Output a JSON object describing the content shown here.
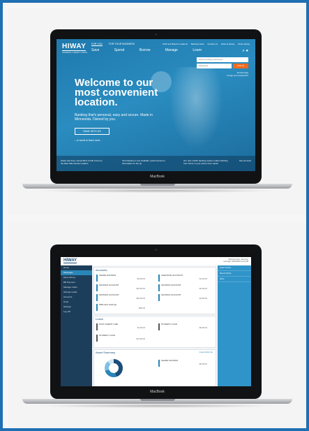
{
  "laptop_label": "MacBook",
  "website": {
    "logo": "HIWAY",
    "logo_sub": "FEDERAL CREDIT UNION",
    "tabs": [
      "FOR YOU",
      "FOR YOUR BUSINESS"
    ],
    "nav": [
      "Save",
      "Spend",
      "Borrow",
      "Manage",
      "Learn"
    ],
    "top_links": [
      "ATM and Branch Locations",
      "Banking Tools",
      "Contact Us",
      "Work at Hiway",
      "About Hiway"
    ],
    "login": {
      "username_placeholder": "Online banking username",
      "password_placeholder": "Password",
      "button": "LOG IN",
      "enroll": "Enroll today",
      "forgot": "Forgot your password?"
    },
    "hero_title": "Welcome to our most convenient location.",
    "hero_sub": "Banking that's personal, easy and secure. Made in Minnesota. Owned by you.",
    "bank_button": "BANK WITH US",
    "scroll_hint": "or scroll to learn more",
    "news": [
      "Hiway has been named Best Credit Union by the East Side Review readers",
      "Text banking is now available. Quick access to information on the go",
      "Our new mobile banking system makes banking from home or your phone even easier",
      "See all news"
    ]
  },
  "app": {
    "logo": "HIWAY",
    "user": "Welcome back, Jane Doe",
    "user_sub": "Last login: 09/06/2018 11:23 AM",
    "sidebar": [
      "Home",
      "Messages",
      "Move Money",
      "Bill Payment",
      "Manage Cards",
      "Savings Goals",
      "Accounts",
      "Tools",
      "Settings",
      "Log Off"
    ],
    "accounts_title": "Accounts",
    "accounts": [
      {
        "name": "SHARE SAVINGS",
        "amount": "$5,000.00"
      },
      {
        "name": "CHECKING ACCOUNT",
        "amount": "$1,000.00"
      },
      {
        "name": "SAVINGS ACCOUNT",
        "amount": "$15,000.00"
      },
      {
        "name": "SAVINGS ACCOUNT",
        "amount": "$2,000.00"
      },
      {
        "name": "SAVINGS ACCOUNT",
        "amount": "$20,000.00"
      },
      {
        "name": "SAVINGS ACCOUNT",
        "amount": "$3,000.00"
      },
      {
        "name": "Millionaire Savings",
        "amount": "$500.00"
      }
    ],
    "loans_title": "Loans",
    "loans": [
      {
        "name": "FAST CREDIT LINE",
        "amount": "$1,000.00"
      },
      {
        "name": "STUDENT LOAN",
        "amount": "$8,000.00"
      },
      {
        "name": "STUDENT LOAN",
        "amount": "$12,000.00"
      }
    ],
    "asset_title": "Asset Summary",
    "asset_tabs": [
      "Assets",
      "Debts",
      "Net"
    ],
    "asset_detail": {
      "name": "SHARE SAVINGS",
      "amount": "$5,000.00"
    },
    "right_pane": [
      "Quick Transfer",
      "Recent Activity",
      "Alerts"
    ],
    "donut": [
      {
        "share": 0.45,
        "color": "#1b4d7a"
      },
      {
        "share": 0.25,
        "color": "#2a86b8"
      },
      {
        "share": 0.18,
        "color": "#7cc0e3"
      },
      {
        "share": 0.12,
        "color": "#cfe6f4"
      }
    ]
  }
}
